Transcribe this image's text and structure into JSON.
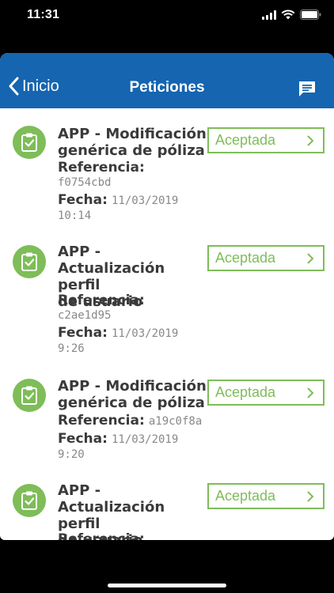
{
  "status_bar": {
    "time": "11:31"
  },
  "nav": {
    "back_label": "Inicio",
    "title": "Peticiones"
  },
  "requests": [
    {
      "title": "APP - Modificación\ngenérica de póliza",
      "ref_label": "Referencia:",
      "ref_value": "f0754cbd",
      "date_label": "Fecha:",
      "date_value": "11/03/2019",
      "time_value": "10:14",
      "status": "Aceptada"
    },
    {
      "title": "APP -\nActualización perfil\nde usuario",
      "ref_label": "Referencia:",
      "ref_value": "c2ae1d95",
      "date_label": "Fecha:",
      "date_value": "11/03/2019",
      "time_value": "9:26",
      "status": "Aceptada"
    },
    {
      "title": "APP - Modificación\ngenérica de póliza",
      "ref_label": "Referencia:",
      "ref_value": "a19c0f8a",
      "date_label": "Fecha:",
      "date_value": "11/03/2019",
      "time_value": "9:20",
      "status": "Aceptada"
    },
    {
      "title": "APP -\nActualización perfil\nde usuario",
      "ref_label": "Referencia:",
      "ref_value": "",
      "status": "Aceptada"
    }
  ],
  "colors": {
    "nav_bg": "#1565b0",
    "accent_green": "#7ebd58"
  },
  "icons": {
    "back": "chevron-left-icon",
    "chat": "chat-bubble-icon",
    "request": "clipboard-check-icon",
    "status": "chevron-right-icon"
  }
}
